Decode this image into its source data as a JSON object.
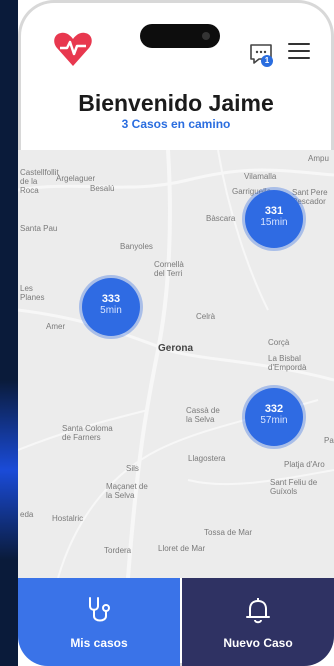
{
  "header": {
    "title": "Bienvenido Jaime",
    "subtitle": "3 Casos en camino",
    "notification_count": "1",
    "logo_icon": "heart-pulse-icon",
    "chat_icon": "chat-icon",
    "menu_icon": "hamburger-menu-icon"
  },
  "map": {
    "places": [
      {
        "label": "Ampu",
        "key": "p0"
      },
      {
        "label": "Vilamalla",
        "key": "p1"
      },
      {
        "label": "Figueres",
        "key": "p2"
      },
      {
        "label": "Garriguella",
        "key": "p3"
      },
      {
        "label": "Sant Pere Pescador",
        "key": "p4"
      },
      {
        "label": "Bàscara",
        "key": "p5"
      },
      {
        "label": "Besalú",
        "key": "p6"
      },
      {
        "label": "Argelaguer",
        "key": "p7"
      },
      {
        "label": "Castellfollit de la Roca",
        "key": "p8"
      },
      {
        "label": "Santa Pau",
        "key": "p9"
      },
      {
        "label": "Banyoles",
        "key": "p10"
      },
      {
        "label": "Cornellà del Terri",
        "key": "p11"
      },
      {
        "label": "Les Planes",
        "key": "p12"
      },
      {
        "label": "Amer",
        "key": "p13"
      },
      {
        "label": "Celrà",
        "key": "p14"
      },
      {
        "label": "Gerona",
        "key": "p15"
      },
      {
        "label": "Corçà",
        "key": "p16"
      },
      {
        "label": "La Bisbal d'Empordà",
        "key": "p17"
      },
      {
        "label": "Cassà de la Selva",
        "key": "p18"
      },
      {
        "label": "Santa Coloma de Farners",
        "key": "p19"
      },
      {
        "label": "Llagostera",
        "key": "p20"
      },
      {
        "label": "Sils",
        "key": "p21"
      },
      {
        "label": "Platja d'Aro",
        "key": "p22"
      },
      {
        "label": "Pa",
        "key": "p23"
      },
      {
        "label": "Maçanet de la Selva",
        "key": "p24"
      },
      {
        "label": "Sant Feliu de Guíxols",
        "key": "p25"
      },
      {
        "label": "Hostalric",
        "key": "p26"
      },
      {
        "label": "Tossa de Mar",
        "key": "p27"
      },
      {
        "label": "Lloret de Mar",
        "key": "p28"
      },
      {
        "label": "Tordera",
        "key": "p29"
      },
      {
        "label": "eda",
        "key": "p30"
      }
    ],
    "clusters": [
      {
        "id": "331",
        "time": "15min"
      },
      {
        "id": "333",
        "time": "5min"
      },
      {
        "id": "332",
        "time": "57min"
      }
    ]
  },
  "footer": {
    "left": {
      "label": "Mis casos",
      "icon": "stethoscope-icon",
      "color": "#3a73e8"
    },
    "right": {
      "label": "Nuevo Caso",
      "icon": "bell-icon",
      "color": "#2f3263"
    }
  },
  "colors": {
    "accent": "#2a6ddf",
    "logo": "#e8384f",
    "cluster": "#2f6be3"
  }
}
